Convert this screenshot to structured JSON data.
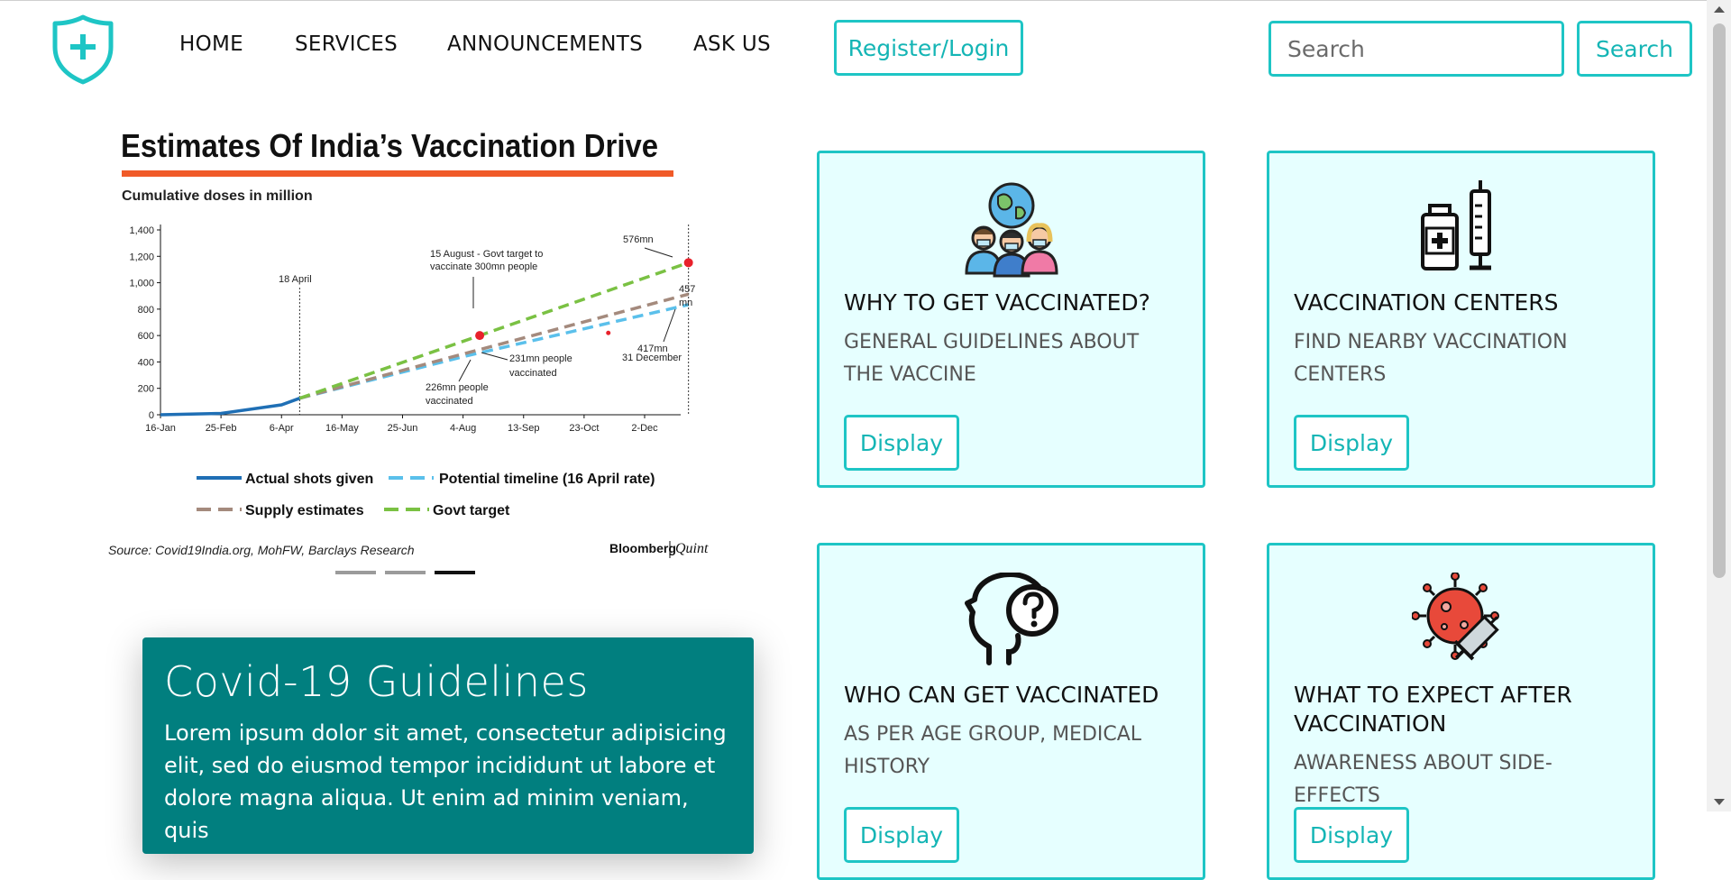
{
  "nav": {
    "items": [
      "HOME",
      "SERVICES",
      "ANNOUNCEMENTS",
      "ASK US"
    ],
    "register_label": "Register/Login",
    "search_placeholder": "Search",
    "search_button": "Search",
    "logo_icon": "shield-plus-icon"
  },
  "carousel": {
    "slides": 3,
    "active_index": 2,
    "chart": {
      "title": "Estimates Of India’s Vaccination Drive",
      "subtitle": "Cumulative doses in million",
      "source": "Source: Covid19India.org, MohFW, Barclays Research",
      "brand_a": "Bloomberg",
      "brand_b": "Quint",
      "annotations": {
        "april": "18 April",
        "aug_target_1": "15 August - Govt target to",
        "aug_target_2": "vaccinate 300mn people",
        "end_576": "576mn",
        "end_457a": "457",
        "end_457b": "mn",
        "end_417a": "417mn",
        "end_417b": "31 December",
        "p231a": "231mn people",
        "p231b": "vaccinated",
        "p226a": "226mn people",
        "p226b": "vaccinated"
      }
    }
  },
  "chart_data": {
    "type": "line",
    "title": "Estimates Of India’s Vaccination Drive",
    "subtitle": "Cumulative doses in million",
    "x_tick_labels": [
      "16-Jan",
      "25-Feb",
      "6-Apr",
      "16-May",
      "25-Jun",
      "4-Aug",
      "13-Sep",
      "23-Oct",
      "2-Dec"
    ],
    "y_tick_labels": [
      "0",
      "200",
      "400",
      "600",
      "800",
      "1,000",
      "1,200",
      "1,400"
    ],
    "ylim": [
      0,
      1400
    ],
    "legend": [
      "Actual shots given",
      "Potential timeline (16 April rate)",
      "Supply estimates",
      "Govt target"
    ],
    "legend_position": "bottom",
    "series": [
      {
        "name": "Actual shots given",
        "color": "#1f6fb5",
        "style": "solid",
        "x": [
          "16-Jan",
          "25-Feb",
          "6-Apr",
          "18-Apr"
        ],
        "y": [
          0,
          10,
          75,
          125
        ]
      },
      {
        "name": "Potential timeline (16 April rate)",
        "color": "#5bc0eb",
        "style": "dashed",
        "x": [
          "18-Apr",
          "4-Aug",
          "31-Dec"
        ],
        "y": [
          125,
          440,
          834
        ]
      },
      {
        "name": "Supply estimates",
        "color": "#a48a7d",
        "style": "dashed",
        "x": [
          "18-Apr",
          "4-Aug",
          "31-Dec"
        ],
        "y": [
          125,
          460,
          914
        ]
      },
      {
        "name": "Govt target",
        "color": "#7ac143",
        "style": "dashed",
        "x": [
          "18-Apr",
          "15-Aug",
          "31-Dec"
        ],
        "y": [
          125,
          600,
          1152
        ]
      }
    ]
  },
  "guidelines": {
    "title": "Covid-19 Guidelines",
    "body": "Lorem ipsum dolor sit amet, consectetur adipisicing elit, sed do eiusmod tempor incididunt ut labore et dolore magna aliqua. Ut enim ad minim veniam, quis"
  },
  "cards": [
    {
      "title": "WHY TO GET VACCINATED?",
      "subtitle": "GENERAL GUIDELINES ABOUT THE VACCINE",
      "button": "Display",
      "icon": "people-globe-icon"
    },
    {
      "title": "VACCINATION CENTERS",
      "subtitle": "FIND NEARBY VACCINATION CENTERS",
      "button": "Display",
      "icon": "vaccine-bottle-syringe-icon"
    },
    {
      "title": "WHO CAN GET VACCINATED",
      "subtitle": "AS PER AGE GROUP, MEDICAL HISTORY",
      "button": "Display",
      "icon": "head-question-icon"
    },
    {
      "title": "WHAT TO EXPECT AFTER VACCINATION",
      "subtitle": "AWARENESS ABOUT SIDE-EFFECTS",
      "button": "Display",
      "icon": "virus-syringe-icon"
    }
  ],
  "colors": {
    "accent": "#1ec5c5",
    "card_bg": "#e6ffff",
    "guidelines_bg": "#017f7f"
  }
}
